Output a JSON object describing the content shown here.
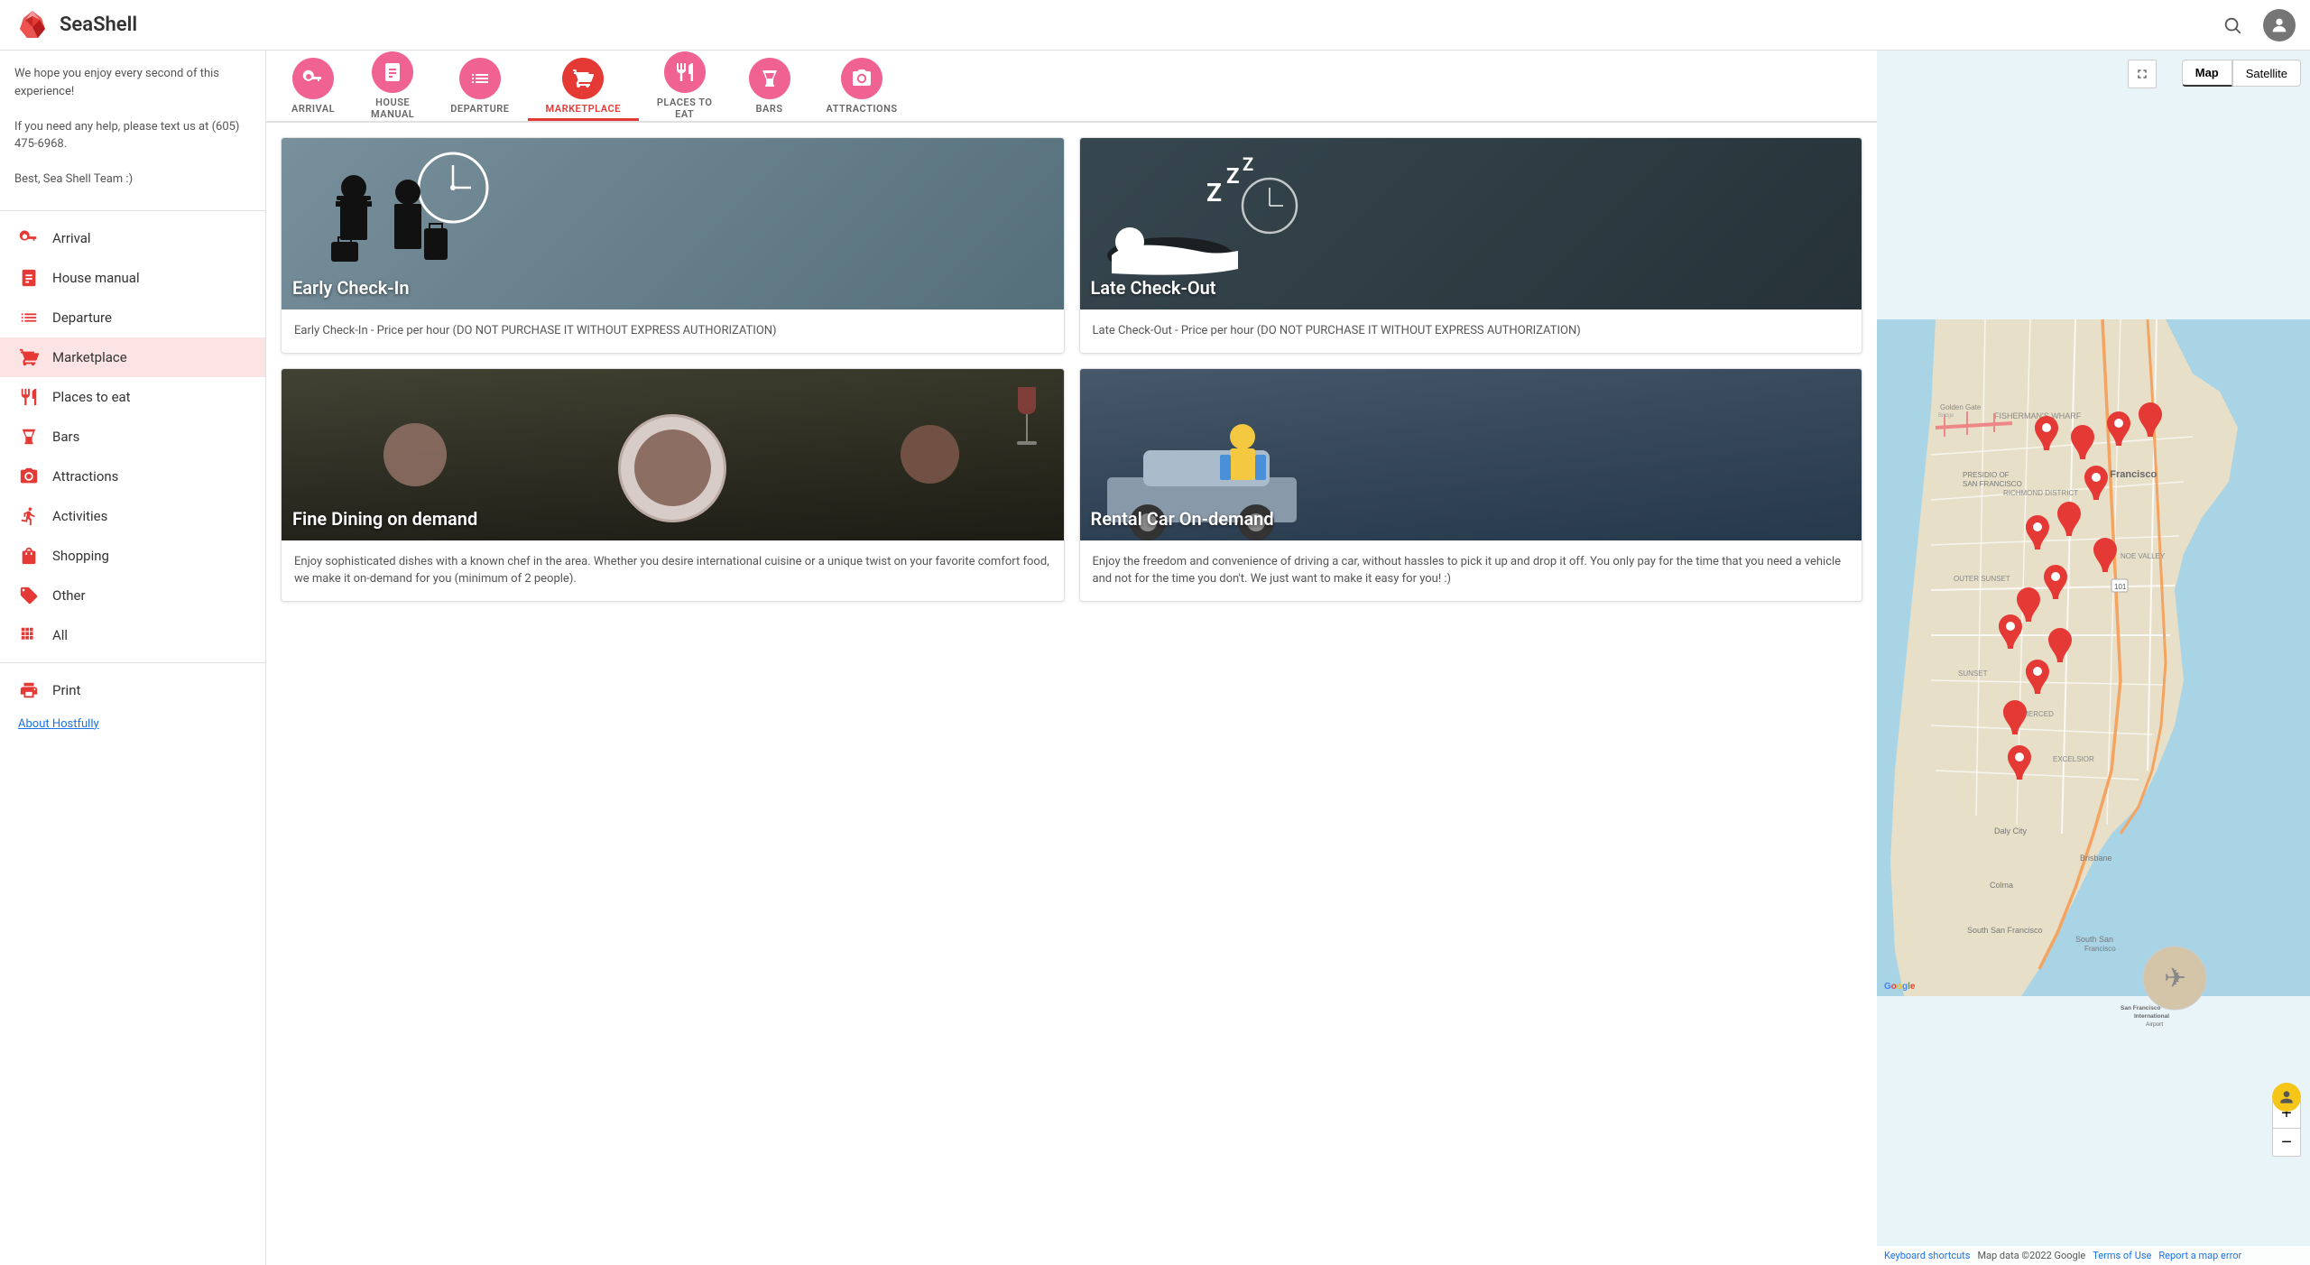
{
  "header": {
    "logo_text": "SeaShell",
    "search_label": "search",
    "avatar_label": "user avatar"
  },
  "sidebar": {
    "intro_lines": [
      "We hope you enjoy every second of this experience!",
      "",
      "If you need any help, please text us at (605) 475-6968.",
      "",
      "Best, Sea Shell Team :)"
    ],
    "items": [
      {
        "id": "arrival",
        "label": "Arrival",
        "icon": "key"
      },
      {
        "id": "house-manual",
        "label": "House manual",
        "icon": "book"
      },
      {
        "id": "departure",
        "label": "Departure",
        "icon": "list"
      },
      {
        "id": "marketplace",
        "label": "Marketplace",
        "icon": "cart",
        "active": true
      },
      {
        "id": "places-to-eat",
        "label": "Places to eat",
        "icon": "fork"
      },
      {
        "id": "bars",
        "label": "Bars",
        "icon": "glass"
      },
      {
        "id": "attractions",
        "label": "Attractions",
        "icon": "camera"
      },
      {
        "id": "activities",
        "label": "Activities",
        "icon": "activity"
      },
      {
        "id": "shopping",
        "label": "Shopping",
        "icon": "bag"
      },
      {
        "id": "other",
        "label": "Other",
        "icon": "tag"
      },
      {
        "id": "all",
        "label": "All",
        "icon": "grid"
      },
      {
        "id": "print",
        "label": "Print",
        "icon": "print"
      }
    ],
    "about_link": "About Hostfully"
  },
  "tabs": [
    {
      "id": "arrival",
      "label": "ARRIVAL",
      "icon": "key"
    },
    {
      "id": "house-manual",
      "label": "HOUSE\nMANUAL",
      "icon": "book"
    },
    {
      "id": "departure",
      "label": "DEPARTURE",
      "icon": "list"
    },
    {
      "id": "marketplace",
      "label": "MARKETPLACE",
      "icon": "cart",
      "active": true
    },
    {
      "id": "places-to-eat",
      "label": "PLACES TO\nEAT",
      "icon": "fork"
    },
    {
      "id": "bars",
      "label": "BARS",
      "icon": "glass"
    },
    {
      "id": "attractions",
      "label": "ATTRACTIONS",
      "icon": "camera"
    }
  ],
  "cards": [
    {
      "id": "early-checkin",
      "title": "Early Check-In",
      "bg_class": "checkin-bg",
      "icon": "🕐👤",
      "description": "Early Check-In - Price per hour (DO NOT PURCHASE IT WITHOUT EXPRESS AUTHORIZATION)"
    },
    {
      "id": "late-checkout",
      "title": "Late Check-Out",
      "bg_class": "checkout-bg",
      "icon": "💤🕐",
      "description": "Late Check-Out - Price per hour (DO NOT PURCHASE IT WITHOUT EXPRESS AUTHORIZATION)"
    },
    {
      "id": "fine-dining",
      "title": "Fine Dining on demand",
      "bg_class": "dining-bg",
      "icon": "🍽️",
      "description": "Enjoy sophisticated dishes with a known chef in the area. Whether you desire international cuisine or a unique twist on your favorite comfort food, we make it on-demand for you (minimum of 2 people)."
    },
    {
      "id": "rental-car",
      "title": "Rental Car On-demand",
      "bg_class": "rental-bg",
      "icon": "🚗",
      "description": "Enjoy the freedom and convenience of driving a car, without hassles to pick it up and drop it off. You only pay for the time that you need a vehicle and not for the time you don't. We just want to make it easy for you! :)"
    }
  ],
  "map": {
    "active_tab": "Map",
    "tabs": [
      "Map",
      "Satellite"
    ],
    "airport_label": "San Francisco International Airport",
    "zoom_in": "+",
    "zoom_out": "−",
    "footer": {
      "keyboard_shortcuts": "Keyboard shortcuts",
      "map_data": "Map data ©2022 Google",
      "terms": "Terms of Use",
      "report": "Report a map error"
    }
  }
}
